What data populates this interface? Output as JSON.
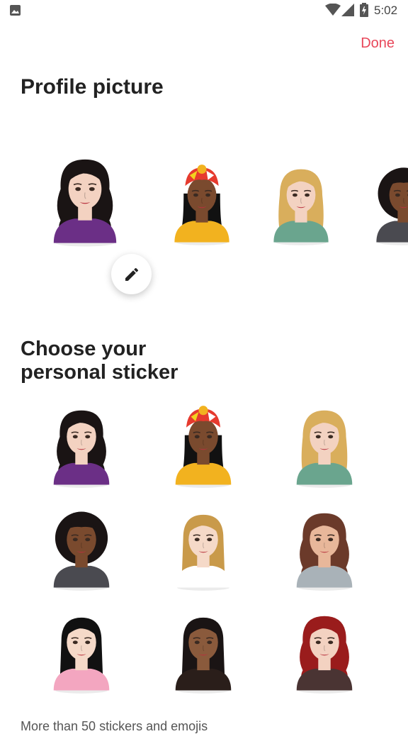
{
  "status_bar": {
    "time": "5:02",
    "icons": [
      "gallery-icon",
      "wifi-icon",
      "signal-icon",
      "battery-icon"
    ]
  },
  "header": {
    "done_label": "Done"
  },
  "profile": {
    "title": "Profile picture",
    "carousel": [
      {
        "name": "avatar-wavy-black",
        "hair": "#1a1414",
        "skin": "#f3d2c1",
        "shirt": "#6b2f86",
        "style": "wavy",
        "selected": true
      },
      {
        "name": "avatar-headwrap",
        "hair": "#111111",
        "skin": "#7a4a2e",
        "shirt": "#f2b21f",
        "style": "wrap",
        "selected": false
      },
      {
        "name": "avatar-blonde",
        "hair": "#d9ae5c",
        "skin": "#f3d2c1",
        "shirt": "#6aa58e",
        "style": "long",
        "selected": false
      },
      {
        "name": "avatar-afro",
        "hair": "#1a1414",
        "skin": "#7a4a2e",
        "shirt": "#4a4a50",
        "style": "afro",
        "selected": false
      }
    ],
    "edit_icon": "pencil-icon"
  },
  "stickers": {
    "title_line1": "Choose your",
    "title_line2": "personal sticker",
    "items": [
      {
        "name": "sticker-wavy-black",
        "hair": "#1a1414",
        "skin": "#f3d2c1",
        "shirt": "#6b2f86",
        "style": "wavy"
      },
      {
        "name": "sticker-headwrap",
        "hair": "#111111",
        "skin": "#7a4a2e",
        "shirt": "#f2b21f",
        "style": "wrap"
      },
      {
        "name": "sticker-blonde",
        "hair": "#d9ae5c",
        "skin": "#f3d2c1",
        "shirt": "#6aa58e",
        "style": "long"
      },
      {
        "name": "sticker-afro",
        "hair": "#1a1414",
        "skin": "#7a4a2e",
        "shirt": "#4a4a50",
        "style": "afro"
      },
      {
        "name": "sticker-straight-blonde",
        "hair": "#c99a4a",
        "skin": "#f5d9c8",
        "shirt": "#ffffff",
        "style": "straight"
      },
      {
        "name": "sticker-curly-brown",
        "hair": "#6b3a2a",
        "skin": "#e8b79a",
        "shirt": "#a9b2b8",
        "style": "wavy"
      },
      {
        "name": "sticker-black-straight-pink",
        "hair": "#111111",
        "skin": "#f5d9c8",
        "shirt": "#f3a6c0",
        "style": "straight"
      },
      {
        "name": "sticker-dark-ombre",
        "hair": "#1a1414",
        "skin": "#8a5a3c",
        "shirt": "#2a1e1a",
        "style": "straight"
      },
      {
        "name": "sticker-red-hair",
        "hair": "#9a1c1c",
        "skin": "#f3d2c1",
        "shirt": "#4a3433",
        "style": "wavy"
      }
    ]
  },
  "bottom_text": "More than 50 stickers and emojis"
}
